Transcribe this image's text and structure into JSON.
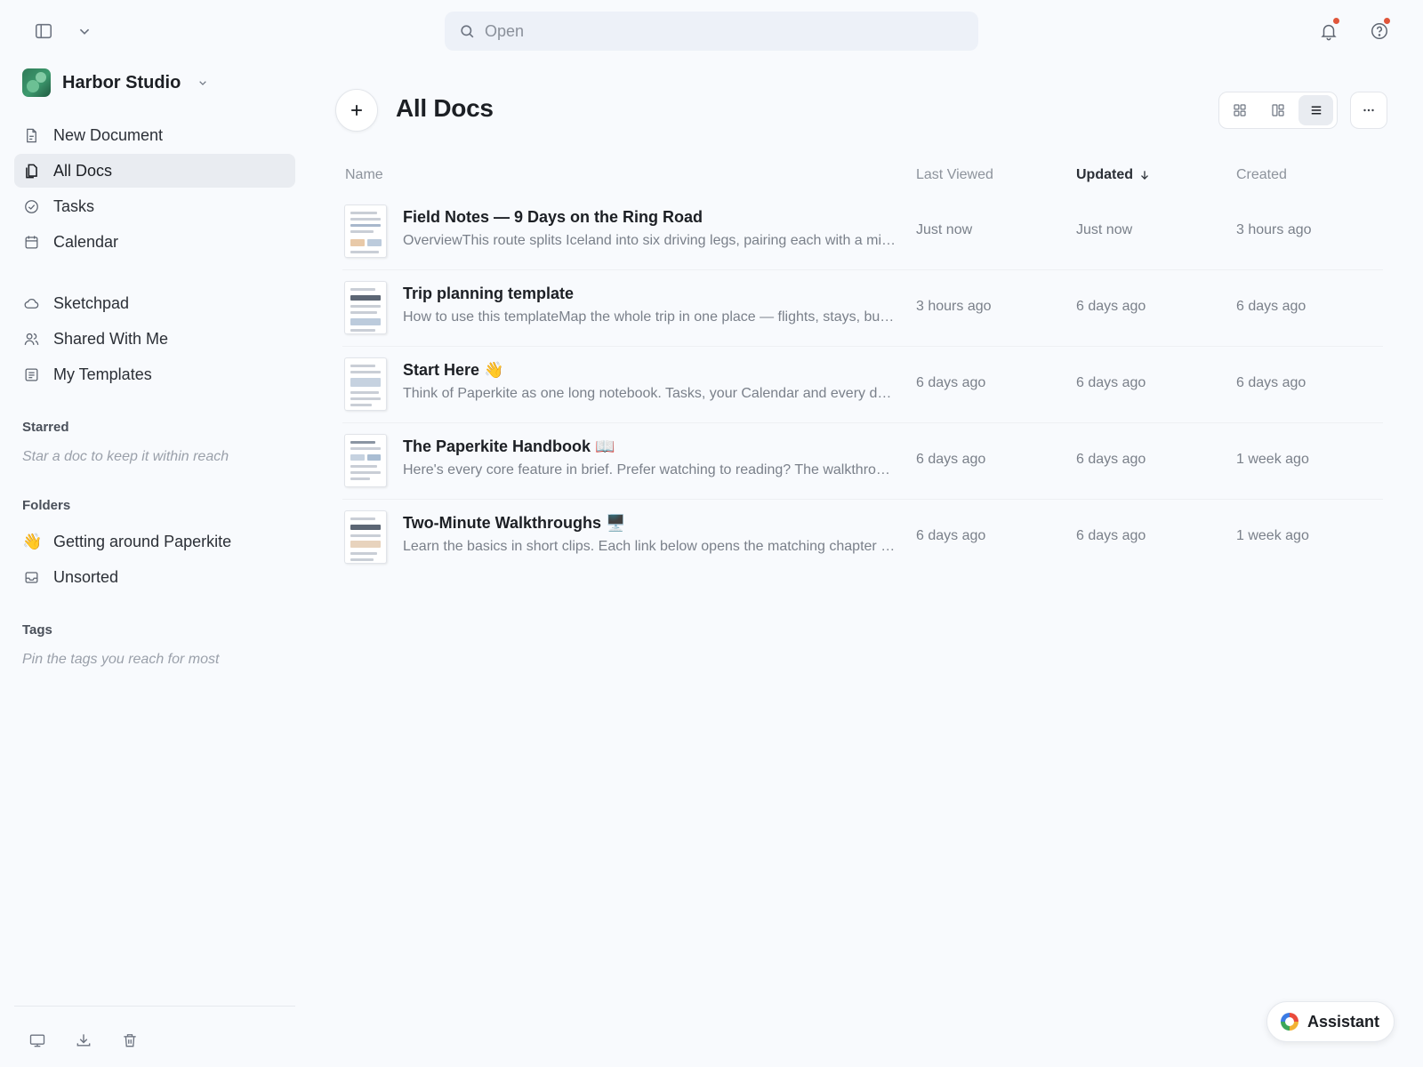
{
  "search": {
    "placeholder": "Open"
  },
  "workspace": {
    "name": "Harbor Studio"
  },
  "sidebar": {
    "nav_primary": [
      {
        "label": "New Document",
        "icon": "new-document-icon"
      },
      {
        "label": "All Docs",
        "icon": "all-docs-icon",
        "active": true
      },
      {
        "label": "Tasks",
        "icon": "tasks-icon"
      },
      {
        "label": "Calendar",
        "icon": "calendar-icon"
      }
    ],
    "nav_secondary": [
      {
        "label": "Sketchpad",
        "icon": "cloud-icon"
      },
      {
        "label": "Shared With Me",
        "icon": "users-icon"
      },
      {
        "label": "My Templates",
        "icon": "templates-icon"
      }
    ],
    "starred": {
      "title": "Starred",
      "hint": "Star a doc to keep it within reach"
    },
    "folders": {
      "title": "Folders",
      "items": [
        {
          "label": "Getting around Paperkite",
          "emoji": "👋"
        },
        {
          "label": "Unsorted",
          "icon": "inbox-icon"
        }
      ]
    },
    "tags": {
      "title": "Tags",
      "hint": "Pin the tags you reach for most"
    }
  },
  "main": {
    "title": "All Docs",
    "columns": {
      "name": "Name",
      "last_viewed": "Last Viewed",
      "updated": "Updated",
      "created": "Created"
    },
    "sorted_by": "updated",
    "rows": [
      {
        "title": "Field Notes — 9 Days on the Ring Road",
        "snippet": "OverviewThis route splits Iceland into six driving legs, pairing each with a mix of stops and overnight stays along the Ring Road",
        "last_viewed": "Just now",
        "updated": "Just now",
        "created": "3 hours ago"
      },
      {
        "title": "Trip planning template",
        "snippet": "How to use this templateMap the whole trip in one place — flights, stays, budget and daily plans all in a single doc",
        "last_viewed": "3 hours ago",
        "updated": "6 days ago",
        "created": "6 days ago"
      },
      {
        "title": "Start Here 👋",
        "snippet": "Think of Paperkite as one long notebook. Tasks, your Calendar and every doc live side by side",
        "last_viewed": "6 days ago",
        "updated": "6 days ago",
        "created": "6 days ago"
      },
      {
        "title": "The Paperkite Handbook 📖",
        "snippet": "Here's every core feature in brief. Prefer watching to reading? The walkthrough videos cover the same ground",
        "last_viewed": "6 days ago",
        "updated": "6 days ago",
        "created": "1 week ago"
      },
      {
        "title": "Two-Minute Walkthroughs 🖥️",
        "snippet": "Learn the basics in short clips. Each link below opens the matching chapter of the handbook",
        "last_viewed": "6 days ago",
        "updated": "6 days ago",
        "created": "1 week ago"
      }
    ]
  },
  "assistant": {
    "label": "Assistant"
  },
  "colors": {
    "accent": "#1c1f24",
    "notification_dot": "#e0563b",
    "active_bg": "#e9ecf1"
  }
}
